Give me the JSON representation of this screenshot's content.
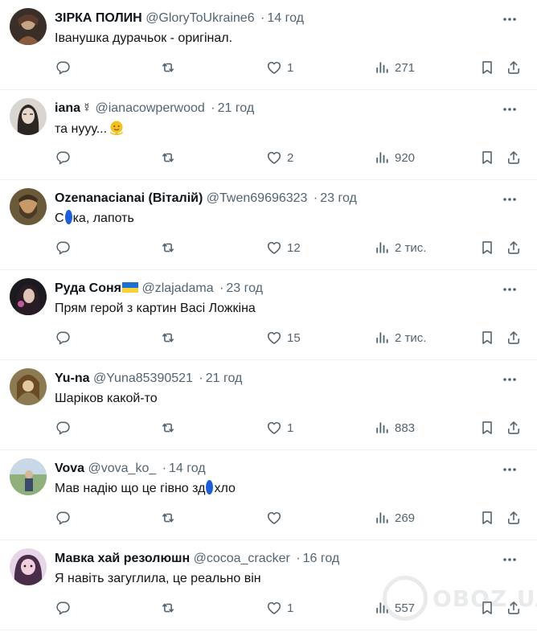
{
  "posts": [
    {
      "name": "ЗІРКА ПОЛИН",
      "handle": "@GloryToUkraine6",
      "dot": "·",
      "time": "14 год",
      "text": "Іванушка дурачьок - оригінал.",
      "replies": "",
      "retweets": "",
      "likes": "1",
      "views": "271"
    },
    {
      "name": "iana",
      "name_suffix": "☿",
      "handle": "@ianacowperwood",
      "dot": "·",
      "time": "21 год",
      "text": "та нууу...",
      "replies": "",
      "retweets": "",
      "likes": "2",
      "views": "920"
    },
    {
      "name": "Ozenanacianai (Віталій)",
      "handle": "@Twen69696323",
      "dot": "·",
      "time": "23 год",
      "text_before": "С",
      "text_after": "ка, лапоть",
      "replies": "",
      "retweets": "",
      "likes": "12",
      "views": "2 тис."
    },
    {
      "name": "Руда Соня",
      "handle": "@zlajadama",
      "dot": "·",
      "time": "23 год",
      "text": "Прям герой з картин Васі Ложкіна",
      "replies": "",
      "retweets": "",
      "likes": "15",
      "views": "2 тис."
    },
    {
      "name": "Yu-na",
      "handle": "@Yuna85390521",
      "dot": "·",
      "time": "21 год",
      "text": "Шаріков какой-то",
      "replies": "",
      "retweets": "",
      "likes": "1",
      "views": "883"
    },
    {
      "name": "Vova",
      "handle": "@vova_ko_",
      "dot": "·",
      "time": "14 год",
      "text_before": "Мав надію що це гівно зд",
      "text_after": "хло",
      "replies": "",
      "retweets": "",
      "likes": "",
      "views": "269"
    },
    {
      "name": "Мавка хай резолюшн",
      "handle": "@cocoa_cracker",
      "dot": "·",
      "time": "16 год",
      "text": "Я навіть загуглила, це реально він",
      "replies": "",
      "retweets": "",
      "likes": "1",
      "views": "557"
    }
  ],
  "icons": {
    "more": "more-options-icon",
    "reply": "reply-icon",
    "retweet": "retweet-icon",
    "like": "heart-icon",
    "views": "views-icon",
    "bookmark": "bookmark-icon",
    "share": "share-icon"
  },
  "colors": {
    "text": "#0f1419",
    "secondary": "#536471",
    "divider": "#eff3f4",
    "flag_blue": "#1d6fd1",
    "flag_yellow": "#f7d23b",
    "censor_blob": "#1d5fd8"
  },
  "watermark": {
    "text": "OBOZ.UA"
  }
}
